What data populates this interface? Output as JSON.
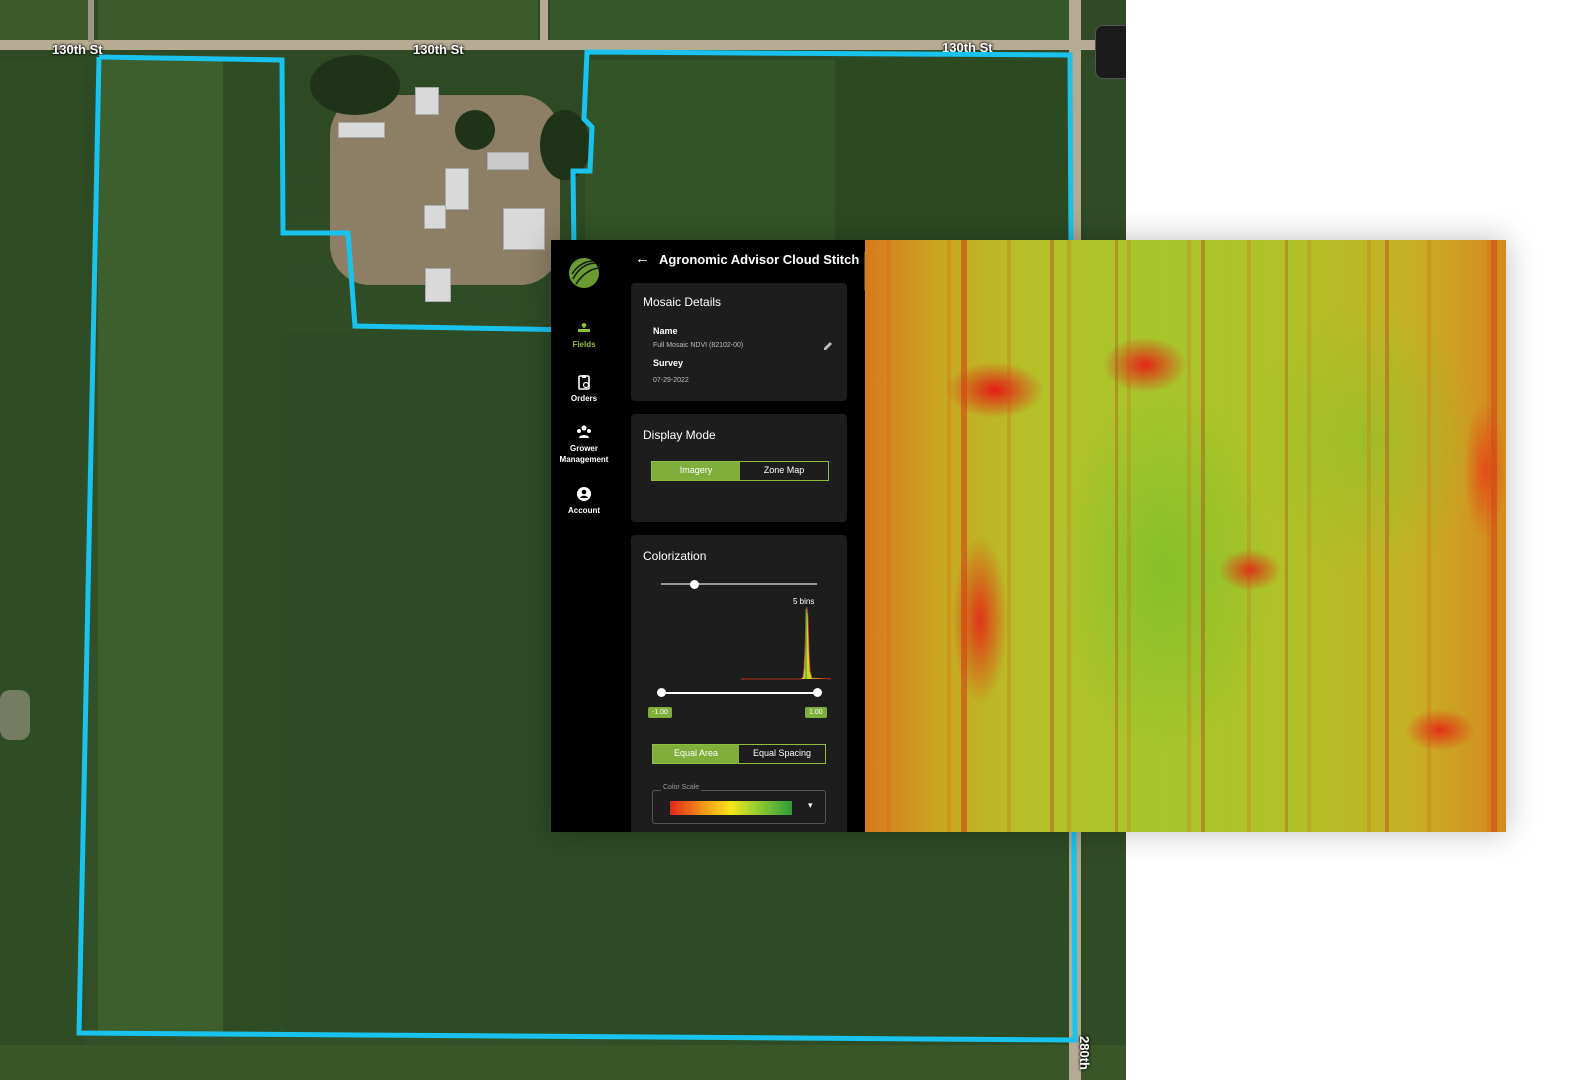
{
  "map": {
    "road_labels": [
      "130th St",
      "130th St",
      "130th St",
      "280th"
    ],
    "boundary_color": "#19c3ee"
  },
  "nav": {
    "items": [
      {
        "label": "Fields",
        "icon": "fields-icon",
        "active": true
      },
      {
        "label": "Orders",
        "icon": "clipboard-icon",
        "active": false
      },
      {
        "label": "Grower Management",
        "icon": "group-icon",
        "active": false
      },
      {
        "label": "Account",
        "icon": "account-icon",
        "active": false
      }
    ]
  },
  "panel": {
    "title": "Agronomic Advisor Cloud Stitchi...",
    "mosaic_details": {
      "title": "Mosaic Details",
      "name_label": "Name",
      "name_value": "Full Mosaic NDVI (82102-00)",
      "survey_label": "Survey",
      "survey_value": "07-29-2022"
    },
    "display_mode": {
      "title": "Display Mode",
      "options": [
        "Imagery",
        "Zone Map"
      ],
      "selected": "Imagery"
    },
    "colorization": {
      "title": "Colorization",
      "bins_label": "5 bins",
      "bins_value": 5,
      "range_min": "-1.00",
      "range_max": "1.00",
      "mode_options": [
        "Equal Area",
        "Equal Spacing"
      ],
      "mode_selected": "Equal Area",
      "color_scale_label": "Color Scale"
    }
  },
  "colors": {
    "accent": "#7fae3a",
    "panel_bg": "#000000",
    "card_bg": "#1d1d1d"
  }
}
